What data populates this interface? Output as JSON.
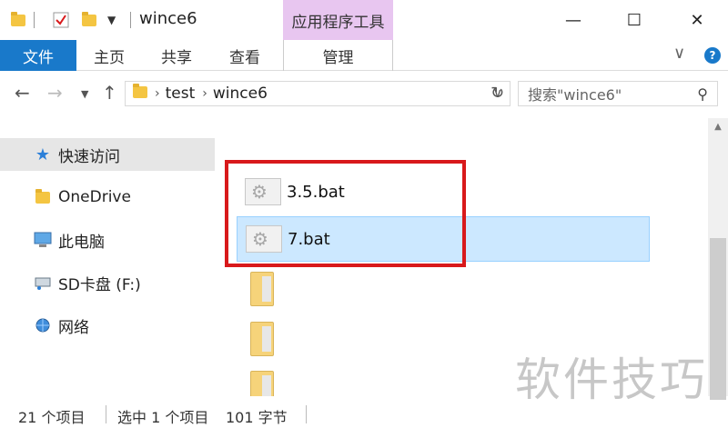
{
  "window": {
    "title": "wince6",
    "context_tab": "应用程序工具",
    "controls": {
      "minimize": "—",
      "maximize": "☐",
      "close": "✕"
    }
  },
  "ribbon": {
    "file_tab": "文件",
    "tabs": [
      "主页",
      "共享",
      "查看"
    ],
    "manage_tab": "管理",
    "help": "?",
    "accent": "#1979ca",
    "context_color": "#e8c6f0"
  },
  "address": {
    "segments": [
      "test",
      "wince6"
    ],
    "search_placeholder": "搜索\"wince6\""
  },
  "nav_pane": {
    "items": [
      {
        "label": "快速访问",
        "icon": "star-icon"
      },
      {
        "label": "OneDrive",
        "icon": "folder-icon"
      },
      {
        "label": "此电脑",
        "icon": "computer-icon"
      },
      {
        "label": "SD卡盘 (F:)",
        "icon": "drive-icon"
      },
      {
        "label": "网络",
        "icon": "network-icon"
      }
    ]
  },
  "files": [
    {
      "name": "3.5.bat",
      "icon": "bat-file-icon",
      "selected": false
    },
    {
      "name": "7.bat",
      "icon": "bat-file-icon",
      "selected": true
    }
  ],
  "status": {
    "item_count": "21 个项目",
    "selected": "选中 1 个项目",
    "size": "101 字节"
  },
  "watermark": "软件技巧",
  "highlight_color": "#d8191b"
}
